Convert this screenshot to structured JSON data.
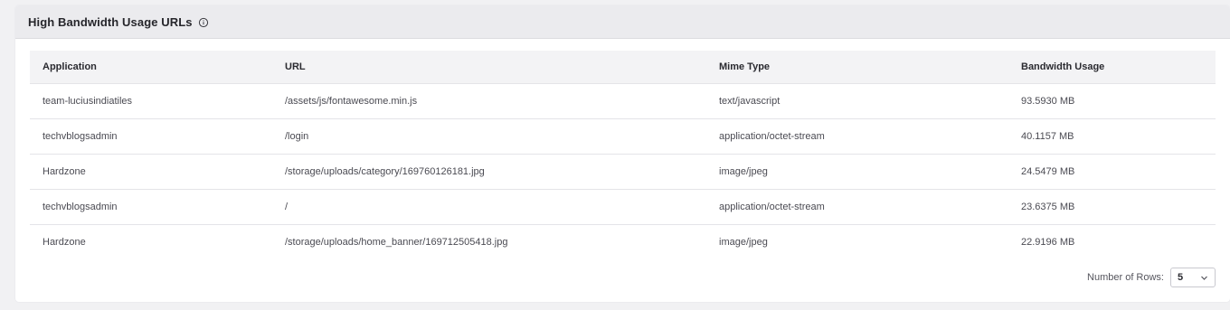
{
  "panel": {
    "title": "High Bandwidth Usage URLs",
    "info_icon": "info-circle-icon"
  },
  "table": {
    "columns": [
      "Application",
      "URL",
      "Mime Type",
      "Bandwidth Usage"
    ],
    "rows": [
      {
        "application": "team-luciusindiatiles",
        "url": "/assets/js/fontawesome.min.js",
        "mime": "text/javascript",
        "bandwidth": "93.5930 MB"
      },
      {
        "application": "techvblogsadmin",
        "url": "/login",
        "mime": "application/octet-stream",
        "bandwidth": "40.1157 MB"
      },
      {
        "application": "Hardzone",
        "url": "/storage/uploads/category/169760126181.jpg",
        "mime": "image/jpeg",
        "bandwidth": "24.5479 MB"
      },
      {
        "application": "techvblogsadmin",
        "url": "/",
        "mime": "application/octet-stream",
        "bandwidth": "23.6375 MB"
      },
      {
        "application": "Hardzone",
        "url": "/storage/uploads/home_banner/169712505418.jpg",
        "mime": "image/jpeg",
        "bandwidth": "22.9196 MB"
      }
    ]
  },
  "pagination": {
    "rows_label": "Number of Rows:",
    "rows_value": "5",
    "dropdown_icon": "chevron-down-icon"
  }
}
